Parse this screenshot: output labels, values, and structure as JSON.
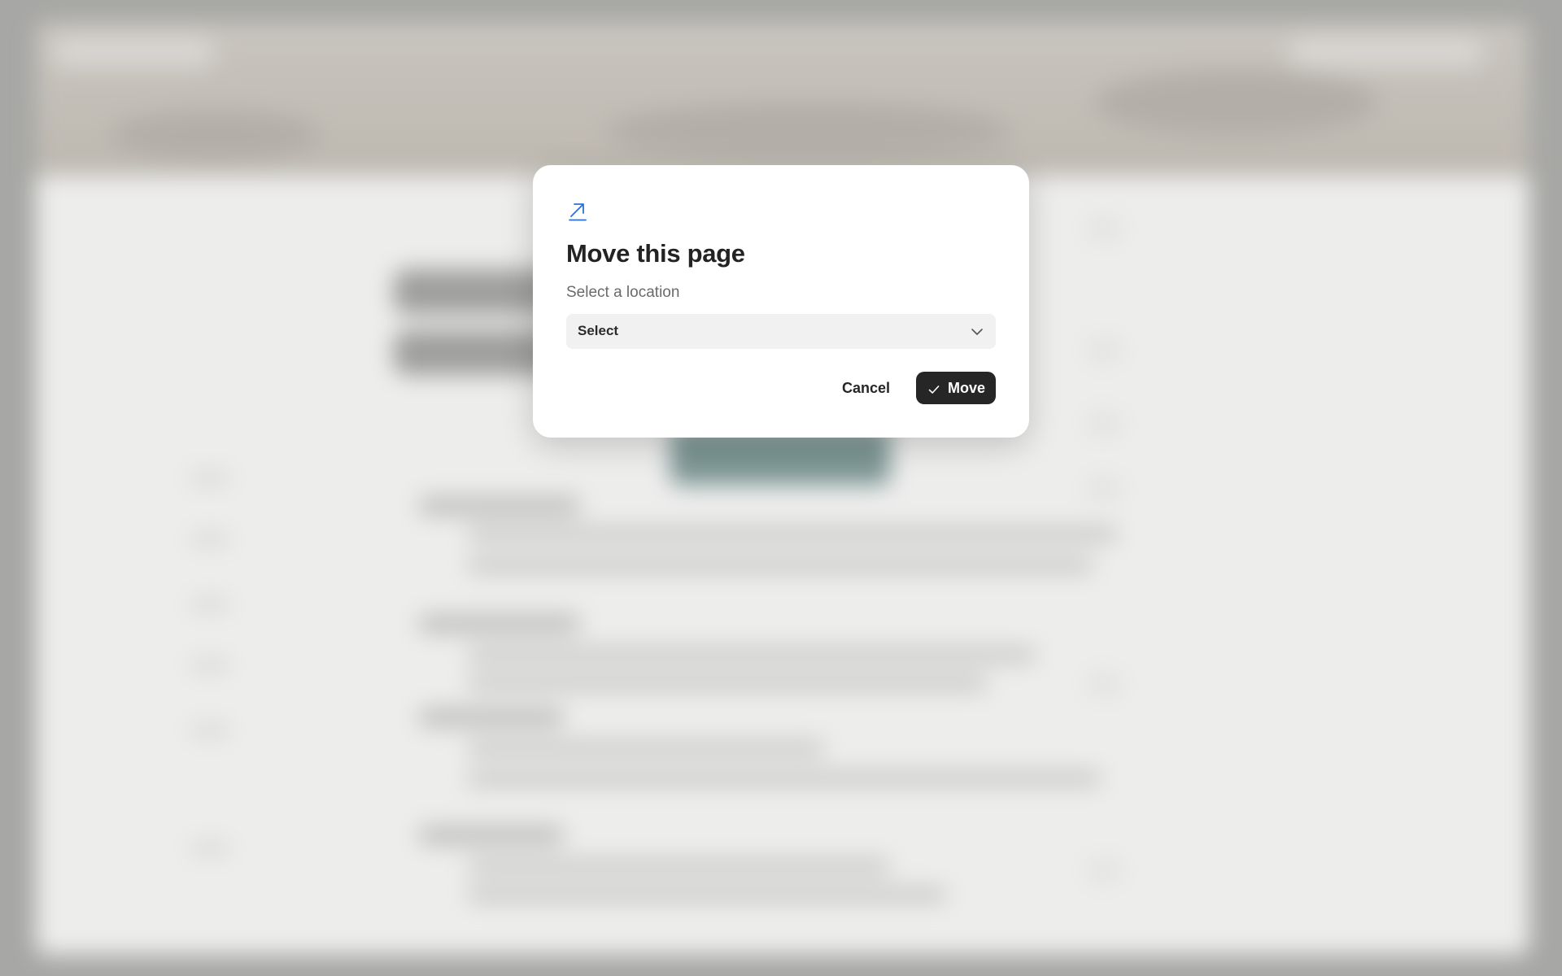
{
  "dialog": {
    "icon": "arrow-up-right-icon",
    "title": "Move this page",
    "subtitle": "Select a location",
    "select": {
      "value": "Select",
      "icon": "chevron-down-icon"
    },
    "cancel_label": "Cancel",
    "move_label": "Move",
    "move_icon": "check-icon"
  },
  "colors": {
    "accent_icon": "#2f6fd6",
    "primary_button": "#262626",
    "overlay": "#a7a7a5",
    "select_bg": "#f1f1f1"
  }
}
